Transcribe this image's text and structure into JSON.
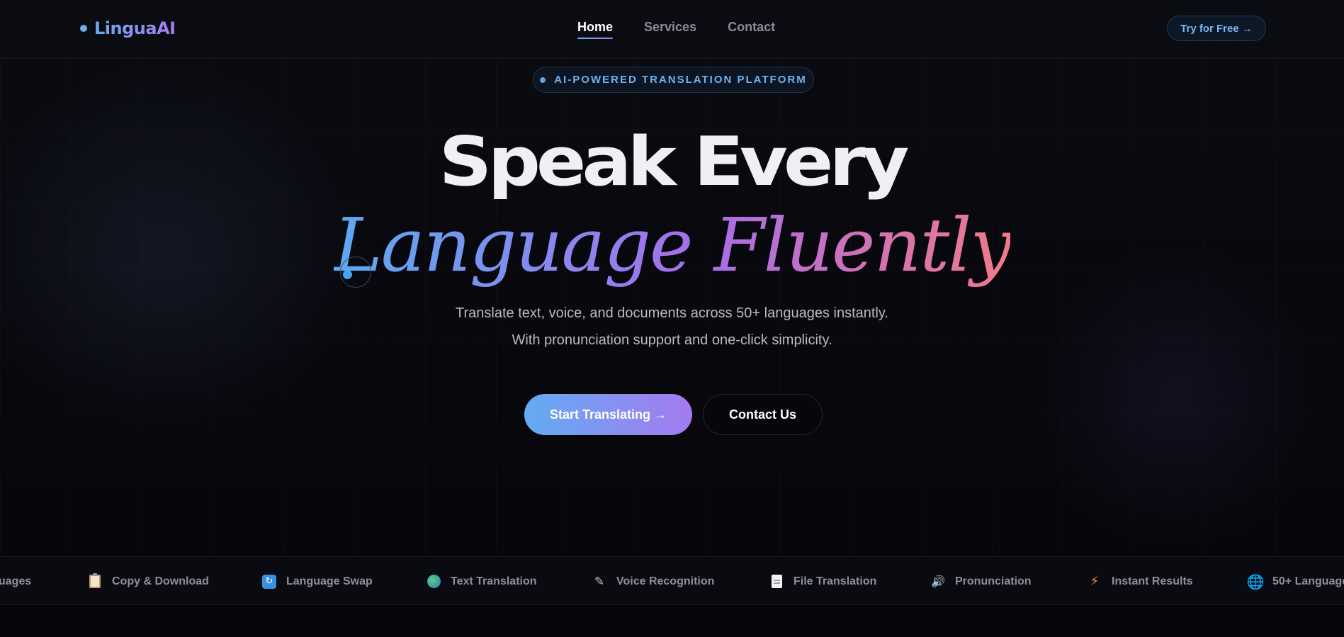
{
  "nav": {
    "logo": "LinguaAI",
    "links": [
      {
        "label": "Home",
        "active": true
      },
      {
        "label": "Services",
        "active": false
      },
      {
        "label": "Contact",
        "active": false
      }
    ],
    "cta_label": "Try for Free →"
  },
  "hero": {
    "badge": "AI-POWERED TRANSLATION PLATFORM",
    "headline_line1": "Speak Every",
    "headline_line2": "Language Fluently",
    "subtitle_line1": "Translate text, voice, and documents across 50+ languages instantly.",
    "subtitle_line2": "With pronunciation support and one-click simplicity.",
    "primary_cta": "Start Translating →",
    "secondary_cta": "Contact Us"
  },
  "features_marquee": [
    {
      "label": "uages",
      "icon": "globe-icon"
    },
    {
      "label": "Copy & Download",
      "icon": "clipboard-icon"
    },
    {
      "label": "Language Swap",
      "icon": "swap-icon"
    },
    {
      "label": "Text Translation",
      "icon": "earth-icon"
    },
    {
      "label": "Voice Recognition",
      "icon": "microphone-icon"
    },
    {
      "label": "File Translation",
      "icon": "file-icon"
    },
    {
      "label": "Pronunciation",
      "icon": "speaker-icon"
    },
    {
      "label": "Instant Results",
      "icon": "lightning-icon"
    },
    {
      "label": "50+ Language",
      "icon": "globe-icon"
    }
  ],
  "colors": {
    "background": "#07070c",
    "accent_blue": "#6aaef0",
    "accent_purple": "#a57af0",
    "accent_pink": "#f07a8a"
  }
}
